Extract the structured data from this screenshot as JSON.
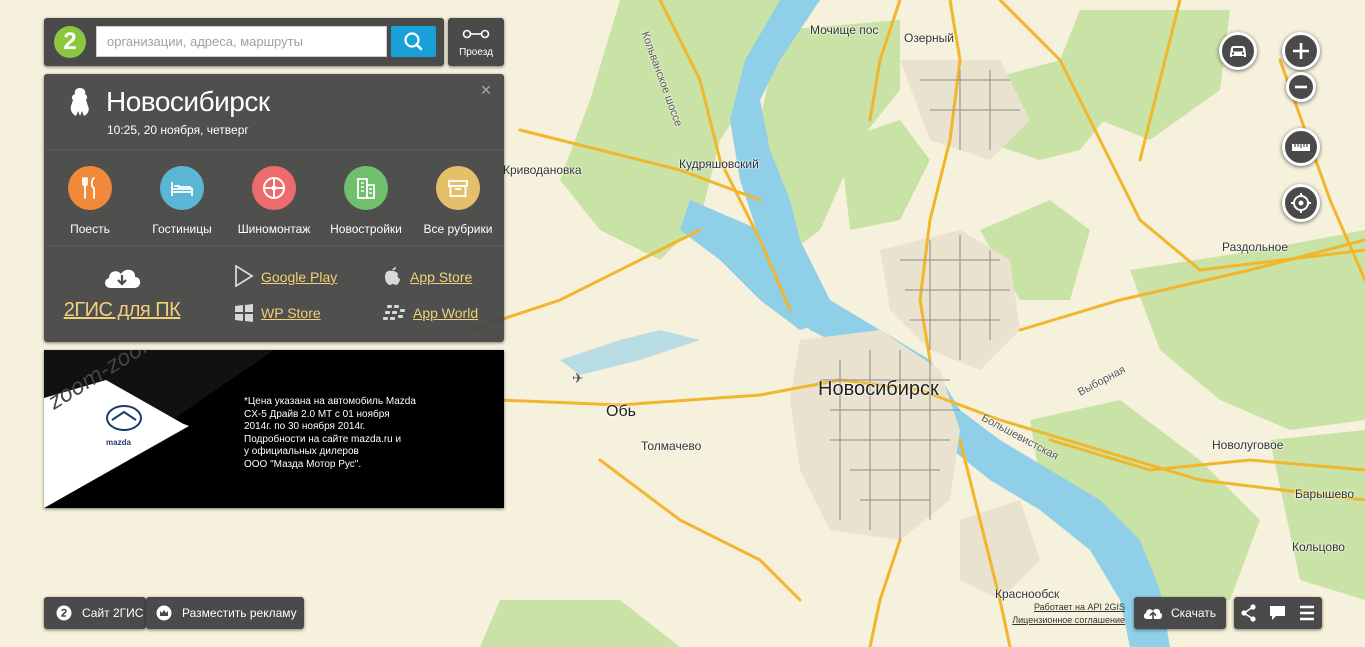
{
  "search": {
    "logo_text": "2",
    "placeholder": "организации, адреса, маршруты",
    "route_label": "Проезд"
  },
  "city": {
    "name": "Новосибирск",
    "datetime": "10:25, 20 ноября, четверг",
    "close": "×"
  },
  "categories": [
    {
      "label": "Поесть",
      "color": "#f08a3a",
      "icon": "fork-knife-icon"
    },
    {
      "label": "Гостиницы",
      "color": "#5bb6d6",
      "icon": "bed-icon"
    },
    {
      "label": "Шиномонтаж",
      "color": "#ee6b6b",
      "icon": "wheel-icon"
    },
    {
      "label": "Новостройки",
      "color": "#6fbf6f",
      "icon": "building-icon"
    },
    {
      "label": "Все рубрики",
      "color": "#e5c06a",
      "icon": "box-icon"
    }
  ],
  "apps": {
    "pc": "2ГИС для ПК",
    "google_play": "Google Play",
    "app_store": "App Store",
    "wp_store": "WP Store",
    "app_world": "App World"
  },
  "ad": {
    "text": "*Цена указана на автомобиль Mazda\n  CX-5 Драйв 2.0 MT с 01 ноября\n  2014г. по 30 ноября 2014г.\n  Подробности на сайте mazda.ru и\n  у официальных дилеров\n  ООО \"Мазда Мотор Рус\".",
    "brand": "mazda",
    "slogan": "zoom-zoom"
  },
  "footer": {
    "site": "Сайт 2ГИС",
    "advertise": "Разместить рекламу",
    "api": "Работает на API 2GIS",
    "license": "Лицензионное соглашение",
    "download": "Скачать"
  },
  "map_labels": [
    {
      "text": "Новосибирск",
      "cls": "big"
    },
    {
      "text": "Обь",
      "cls": "mid"
    },
    {
      "text": "Мочище пос",
      "cls": ""
    },
    {
      "text": "Озерный",
      "cls": ""
    },
    {
      "text": "Кудряшовский",
      "cls": ""
    },
    {
      "text": "Криводановка",
      "cls": ""
    },
    {
      "text": "Раздольное",
      "cls": ""
    },
    {
      "text": "Толмачево",
      "cls": ""
    },
    {
      "text": "Новолуговое",
      "cls": ""
    },
    {
      "text": "Барышево",
      "cls": ""
    },
    {
      "text": "Кольцово",
      "cls": ""
    },
    {
      "text": "Краснообск",
      "cls": ""
    },
    {
      "text": "Большевистская",
      "cls": "road"
    },
    {
      "text": "Выборная",
      "cls": "road"
    },
    {
      "text": "Кольванское шоссе",
      "cls": "road"
    }
  ],
  "colors": {
    "panel": "#4a4a4a",
    "accent": "#1aa0d8",
    "link": "#f2d07a",
    "water": "#8fcfe8",
    "forest": "#c9e3a6",
    "road": "#f2b62c",
    "land": "#f6f1dc"
  }
}
